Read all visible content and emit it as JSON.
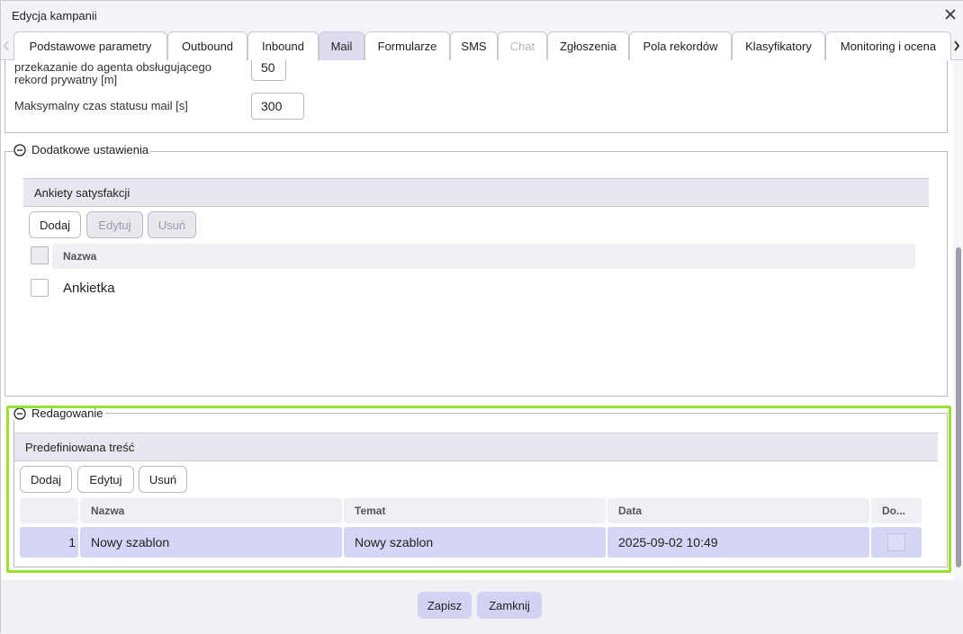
{
  "window": {
    "title": "Edycja kampanii"
  },
  "tabs": [
    {
      "label": "Podstawowe parametry"
    },
    {
      "label": "Outbound"
    },
    {
      "label": "Inbound"
    },
    {
      "label": "Mail"
    },
    {
      "label": "Formularze"
    },
    {
      "label": "SMS"
    },
    {
      "label": "Chat"
    },
    {
      "label": "Zgłoszenia"
    },
    {
      "label": "Pola rekordów"
    },
    {
      "label": "Klasyfikatory"
    },
    {
      "label": "Monitoring i ocena"
    }
  ],
  "active_tab": "Mail",
  "settings": {
    "agent_transfer_label_line1": "przekazanie do agenta obsługującego",
    "agent_transfer_label_line2": "rekord prywatny [m]",
    "agent_transfer_value": "50",
    "max_mail_status_label": "Maksymalny czas statusu mail [s]",
    "max_mail_status_value": "300"
  },
  "additional": {
    "legend": "Dodatkowe ustawienia",
    "surveys_title": "Ankiety satysfakcji",
    "buttons": {
      "add": "Dodaj",
      "edit": "Edytuj",
      "delete": "Usuń"
    },
    "column_name": "Nazwa",
    "rows": [
      {
        "name": "Ankietka"
      }
    ]
  },
  "editing": {
    "legend": "Redagowanie",
    "predefined_title": "Predefiniowana treść",
    "buttons": {
      "add": "Dodaj",
      "edit": "Edytuj",
      "delete": "Usuń"
    },
    "columns": {
      "name": "Nazwa",
      "subject": "Temat",
      "date": "Data",
      "default": "Do..."
    },
    "rows": [
      {
        "index": "1",
        "name": "Nowy szablon",
        "subject": "Nowy szablon",
        "date": "2025-09-02 10:49"
      }
    ]
  },
  "footer": {
    "save": "Zapisz",
    "close": "Zamknij"
  },
  "colors": {
    "accent": "#d2d2f2",
    "highlight_border": "#9ae02e",
    "selected_row": "#d5d5f5"
  }
}
